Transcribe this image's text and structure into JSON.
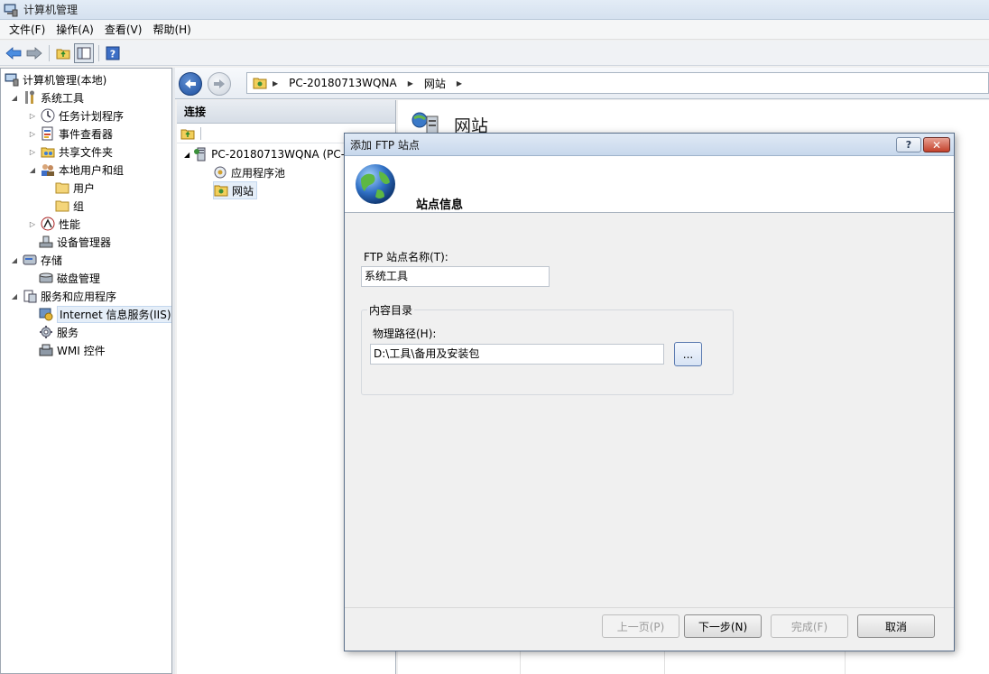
{
  "window": {
    "title": "计算机管理"
  },
  "menu": [
    "文件(F)",
    "操作(A)",
    "查看(V)",
    "帮助(H)"
  ],
  "tree": {
    "root": "计算机管理(本地)",
    "system_tools": "系统工具",
    "task_scheduler": "任务计划程序",
    "event_viewer": "事件查看器",
    "shared_folders": "共享文件夹",
    "local_users_groups": "本地用户和组",
    "users": "用户",
    "groups": "组",
    "performance": "性能",
    "device_manager": "设备管理器",
    "storage": "存储",
    "disk_management": "磁盘管理",
    "services_apps": "服务和应用程序",
    "iis": "Internet 信息服务(IIS)管",
    "services": "服务",
    "wmi": "WMI 控件"
  },
  "address": {
    "computer": "PC-20180713WQNA",
    "site": "网站"
  },
  "connections": {
    "header": "连接",
    "server": "PC-20180713WQNA (PC-",
    "app_pools": "应用程序池",
    "sites": "网站"
  },
  "main": {
    "title": "网站"
  },
  "dialog": {
    "title": "添加 FTP 站点",
    "help": "?",
    "close": "✕",
    "heading": "站点信息",
    "site_name_label": "FTP 站点名称(T):",
    "site_name_value": "系统工具",
    "content_dir_legend": "内容目录",
    "physical_path_label": "物理路径(H):",
    "physical_path_value": "D:\\工具\\备用及安装包",
    "browse": "...",
    "buttons": {
      "prev": "上一页(P)",
      "next": "下一步(N)",
      "finish": "完成(F)",
      "cancel": "取消"
    }
  }
}
